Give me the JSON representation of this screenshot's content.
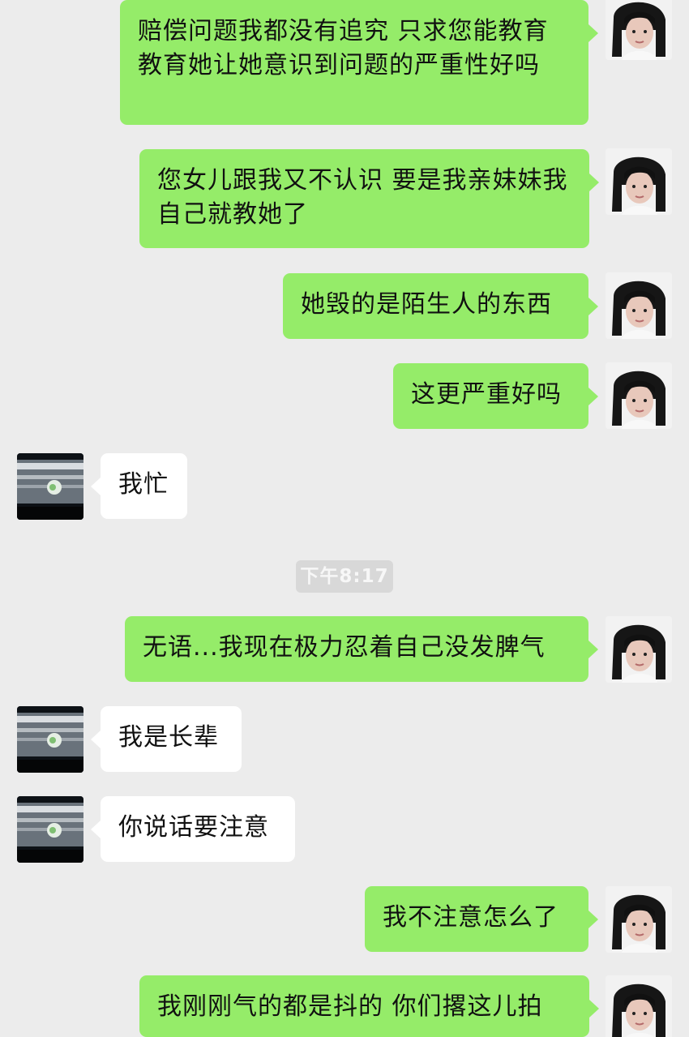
{
  "chat": {
    "messages": [
      {
        "side": "self",
        "text": "赔偿问题我都没有追究 只求您能教育教育她让她意识到问题的严重性好吗"
      },
      {
        "side": "self",
        "text": "您女儿跟我又不认识 要是我亲妹妹我自己就教她了"
      },
      {
        "side": "self",
        "text": "她毁的是陌生人的东西"
      },
      {
        "side": "self",
        "text": "这更严重好吗"
      },
      {
        "side": "other",
        "text": "我忙"
      },
      {
        "side": "self",
        "text": "无语...我现在极力忍着自己没发脾气"
      },
      {
        "side": "other",
        "text": "我是长辈"
      },
      {
        "side": "other",
        "text": "你说话要注意"
      },
      {
        "side": "self",
        "text": "我不注意怎么了"
      },
      {
        "side": "self",
        "text": "我刚刚气的都是抖的 你们撂这儿拍"
      }
    ],
    "timestamp": "下午8:17"
  }
}
